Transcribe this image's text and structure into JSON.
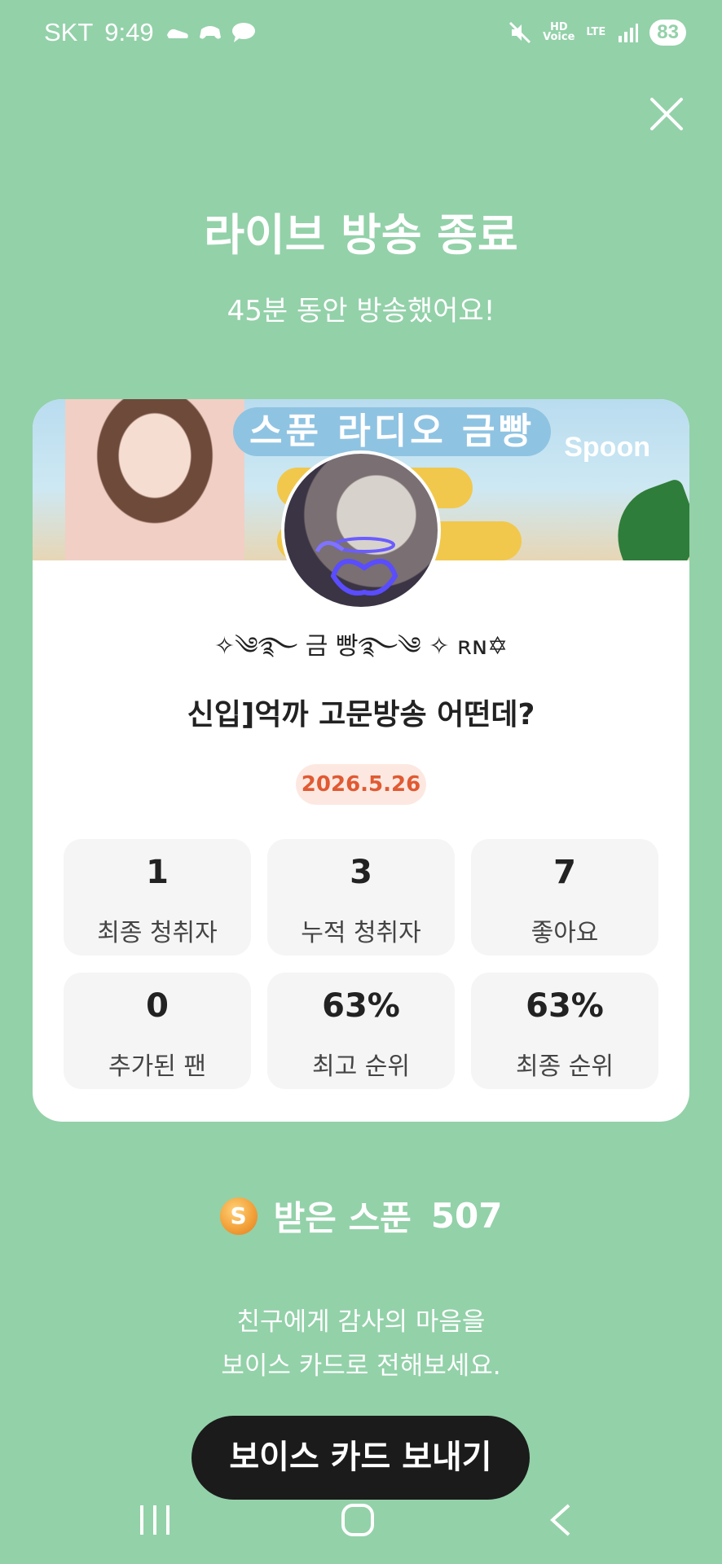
{
  "status_bar": {
    "carrier": "SKT",
    "time": "9:49",
    "hd_voice": "HD\nVoice",
    "network": "LTE",
    "battery": "83"
  },
  "header": {
    "title": "라이브 방송 종료",
    "subtitle": "45분 동안 방송했어요!"
  },
  "card": {
    "banner_text": "스푼 라디오 금빵",
    "banner_logo": "Spoon",
    "host_name": "✧༄࿐ 금 빵࿐༄ ✧ ʀɴ✡",
    "live_title": "신입]억까 고문방송 어떤데?",
    "date": "2026.5.26",
    "stats": [
      {
        "value": "1",
        "label": "최종 청취자"
      },
      {
        "value": "3",
        "label": "누적 청취자"
      },
      {
        "value": "7",
        "label": "좋아요"
      },
      {
        "value": "0",
        "label": "추가된 팬"
      },
      {
        "value": "63%",
        "label": "최고 순위"
      },
      {
        "value": "63%",
        "label": "최종 순위"
      }
    ]
  },
  "spoon": {
    "coin_letter": "S",
    "label": "받은 스푼",
    "count": "507"
  },
  "thanks": {
    "line1": "친구에게 감사의 마음을",
    "line2": "보이스 카드로 전해보세요."
  },
  "send_button": "보이스 카드 보내기",
  "colors": {
    "background": "#93d1a9",
    "date_text": "#e05a33",
    "date_bg": "#fde8e1",
    "button_bg": "#1b1b1b"
  }
}
